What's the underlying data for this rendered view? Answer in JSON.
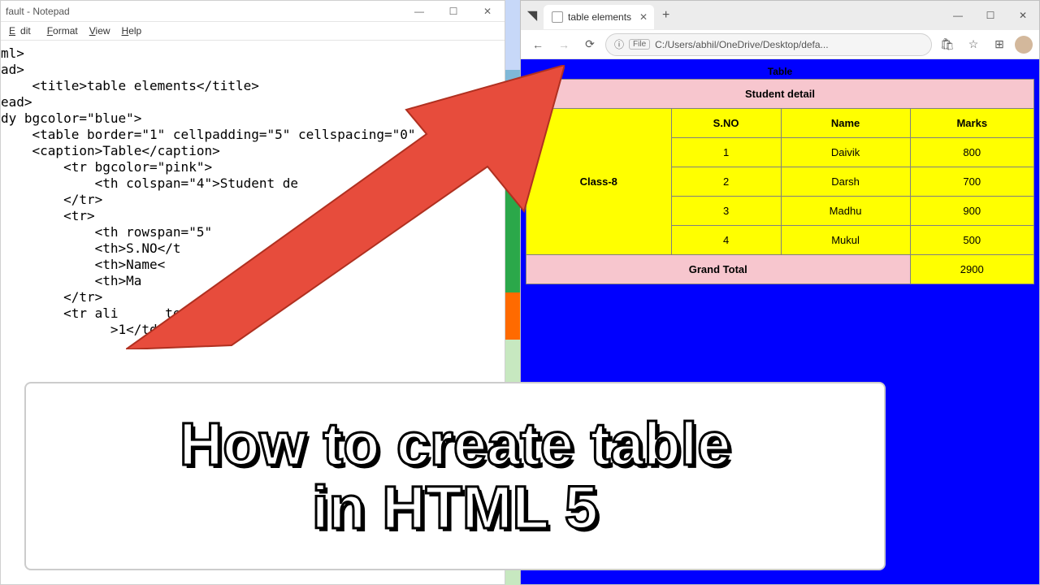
{
  "notepad": {
    "title": "fault - Notepad",
    "menu": {
      "edit": "dit",
      "format": "Format",
      "view": "View",
      "help": "Help"
    },
    "code_lines": [
      "ml>",
      "ad>",
      "    <title>table elements</title>",
      "ead>",
      "dy bgcolor=\"blue\">",
      "    <table border=\"1\" cellpadding=\"5\" cellspacing=\"0\"",
      "    <caption>Table</caption>",
      "        <tr bgcolor=\"pink\">",
      "            <th colspan=\"4\">Student de",
      "        </tr>",
      "        <tr>",
      "            <th rowspan=\"5\"           /th>",
      "            <th>S.NO</t",
      "            <th>Name<",
      "            <th>Ma",
      "        </tr>",
      "        <tr ali      ter\">",
      "              >1</td>"
    ]
  },
  "browser": {
    "tab_title": "table elements",
    "url_label": "File",
    "url": "C:/Users/abhil/OneDrive/Desktop/defa...",
    "page": {
      "caption": "Table",
      "title_row": "Student detail",
      "row_label": "Class-8",
      "headers": [
        "S.NO",
        "Name",
        "Marks"
      ],
      "rows": [
        {
          "sno": "1",
          "name": "Daivik",
          "marks": "800"
        },
        {
          "sno": "2",
          "name": "Darsh",
          "marks": "700"
        },
        {
          "sno": "3",
          "name": "Madhu",
          "marks": "900"
        },
        {
          "sno": "4",
          "name": "Mukul",
          "marks": "500"
        }
      ],
      "grand_label": "Grand Total",
      "grand_value": "2900"
    }
  },
  "headline": "How to create table\nin HTML 5"
}
